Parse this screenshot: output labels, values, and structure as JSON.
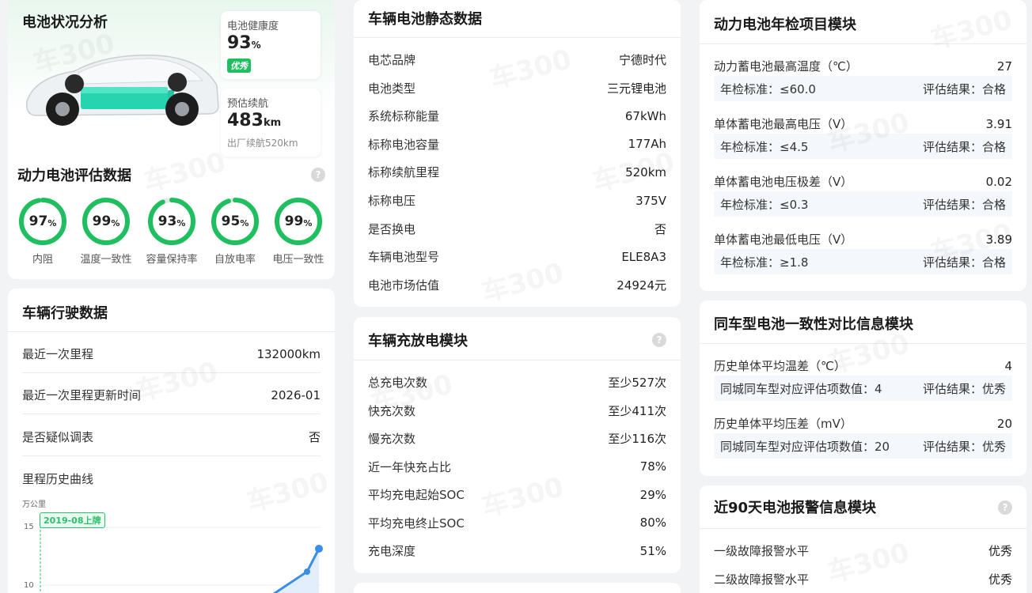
{
  "battery_card": {
    "title": "电池状况分析",
    "health_label": "电池健康度",
    "health_value": "93",
    "health_unit": "%",
    "health_badge": "优秀",
    "range_label": "预估续航",
    "range_value": "483",
    "range_unit": "km",
    "range_factory": "出厂续航520km",
    "eval_title": "动力电池评估数据",
    "rings": [
      {
        "value": "97",
        "unit": "%",
        "label": "内阻",
        "pct": 0.97
      },
      {
        "value": "99",
        "unit": "%",
        "label": "温度一致性",
        "pct": 0.99
      },
      {
        "value": "93",
        "unit": "%",
        "label": "容量保持率",
        "pct": 0.93
      },
      {
        "value": "95",
        "unit": "%",
        "label": "自放电率",
        "pct": 0.95
      },
      {
        "value": "99",
        "unit": "%",
        "label": "电压一致性",
        "pct": 0.99
      }
    ]
  },
  "driving_card": {
    "title": "车辆行驶数据",
    "rows": [
      {
        "label": "最近一次里程",
        "value": "132000km"
      },
      {
        "label": "最近一次里程更新时间",
        "value": "2026-01"
      },
      {
        "label": "是否疑似调表",
        "value": "否"
      }
    ],
    "curve_title": "里程历史曲线",
    "y_unit": "万公里",
    "tick_15": "15",
    "tick_10": "10",
    "tag": "2019-08上牌"
  },
  "static_card": {
    "title": "车辆电池静态数据",
    "rows": [
      {
        "label": "电芯品牌",
        "value": "宁德时代"
      },
      {
        "label": "电池类型",
        "value": "三元锂电池"
      },
      {
        "label": "系统标称能量",
        "value": "67kWh"
      },
      {
        "label": "标称电池容量",
        "value": "177Ah"
      },
      {
        "label": "标称续航里程",
        "value": "520km"
      },
      {
        "label": "标称电压",
        "value": "375V"
      },
      {
        "label": "是否换电",
        "value": "否"
      },
      {
        "label": "车辆电池型号",
        "value": "ELE8A3"
      },
      {
        "label": "电池市场估值",
        "value": "24924元"
      }
    ]
  },
  "charge_card": {
    "title": "车辆充放电模块",
    "rows": [
      {
        "label": "总充电次数",
        "value": "至少527次"
      },
      {
        "label": "快充次数",
        "value": "至少411次"
      },
      {
        "label": "慢充次数",
        "value": "至少116次"
      },
      {
        "label": "近一年快充占比",
        "value": "78%"
      },
      {
        "label": "平均充电起始SOC",
        "value": "29%"
      },
      {
        "label": "平均充电终止SOC",
        "value": "80%"
      },
      {
        "label": "充电深度",
        "value": "51%"
      }
    ]
  },
  "annual_card": {
    "title": "动力电池年检项目模块",
    "items": [
      {
        "label": "动力蓄电池最高温度（℃）",
        "value": "27",
        "std": "年检标准：≤60.0",
        "result": "评估结果：合格"
      },
      {
        "label": "单体蓄电池最高电压（V）",
        "value": "3.91",
        "std": "年检标准：≤4.5",
        "result": "评估结果：合格"
      },
      {
        "label": "单体蓄电池电压极差（V）",
        "value": "0.02",
        "std": "年检标准：≤0.3",
        "result": "评估结果：合格"
      },
      {
        "label": "单体蓄电池最低电压（V）",
        "value": "3.89",
        "std": "年检标准：≥1.8",
        "result": "评估结果：合格"
      }
    ]
  },
  "consistency_card": {
    "title": "同车型电池一致性对比信息模块",
    "items": [
      {
        "label": "历史单体平均温差（℃）",
        "value": "4",
        "std": "同城同车型对应评估项数值：4",
        "result": "评估结果：优秀"
      },
      {
        "label": "历史单体平均压差（mV）",
        "value": "20",
        "std": "同城同车型对应评估项数值：20",
        "result": "评估结果：优秀"
      }
    ]
  },
  "alarm_card": {
    "title": "近90天电池报警信息模块",
    "rows": [
      {
        "label": "一级故障报警水平",
        "value": "优秀"
      },
      {
        "label": "二级故障报警水平",
        "value": "优秀"
      }
    ]
  },
  "help_glyph": "?",
  "watermark": "车300",
  "colors": {
    "green": "#1fbf5f",
    "teal": "#26d4b0",
    "blue": "#3a8de8"
  }
}
